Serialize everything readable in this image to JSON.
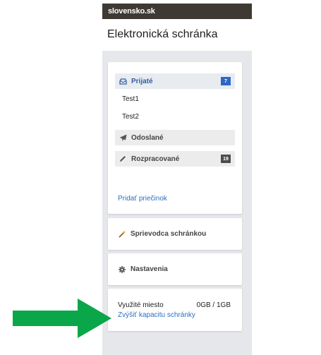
{
  "header": {
    "logo": "slovensko.sk"
  },
  "page": {
    "title": "Elektronická schránka"
  },
  "folders": {
    "inbox": {
      "label": "Prijaté",
      "count": "7",
      "icon": "inbox-icon"
    },
    "subfolders": [
      "Test1",
      "Test2"
    ],
    "sent": {
      "label": "Odoslané",
      "icon": "paper-plane-icon"
    },
    "drafts": {
      "label": "Rozpracované",
      "count": "19",
      "icon": "pencil-icon"
    },
    "add_folder": "Pridať priečinok"
  },
  "guide": {
    "label": "Sprievodca schránkou",
    "icon": "magic-wand-icon"
  },
  "settings": {
    "label": "Nastavenia",
    "icon": "gear-icon"
  },
  "storage": {
    "label": "Využité miesto",
    "value": "0GB / 1GB",
    "increase_link": "Zvýšiť kapacitu schránky"
  },
  "colors": {
    "topbar": "#3e3a33",
    "panel": "#e6e7ea",
    "link": "#2d6fc1",
    "badge_blue": "#2d69c4",
    "badge_dark": "#4a4c50",
    "arrow": "#0aa64a"
  }
}
